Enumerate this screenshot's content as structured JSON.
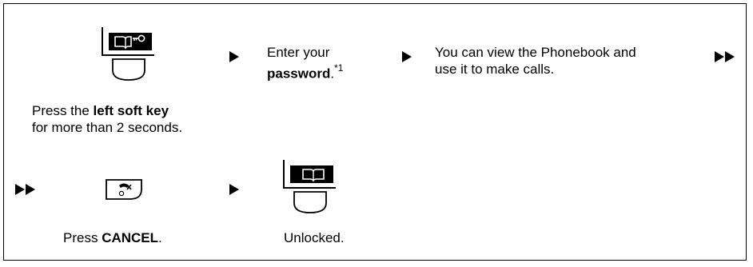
{
  "step1": {
    "icon": "phonebook-lock-softkey-icon",
    "caption_line1_prefix": "Press the ",
    "caption_line1_bold": "left soft key",
    "caption_line2": "for more than 2 seconds."
  },
  "step2": {
    "line1": "Enter your",
    "bold": "password",
    "suffix": ".",
    "footnote": "*1"
  },
  "step3": {
    "line1": "You can view the Phonebook and",
    "line2": "use it to make calls."
  },
  "step4": {
    "icon": "cancel-key-icon",
    "caption_prefix": "Press ",
    "caption_bold": "CANCEL",
    "caption_suffix": "."
  },
  "step5": {
    "icon": "phonebook-softkey-icon",
    "caption": "Unlocked."
  },
  "arrows": {
    "single": "arrow-right-icon",
    "double": "double-arrow-right-icon"
  }
}
